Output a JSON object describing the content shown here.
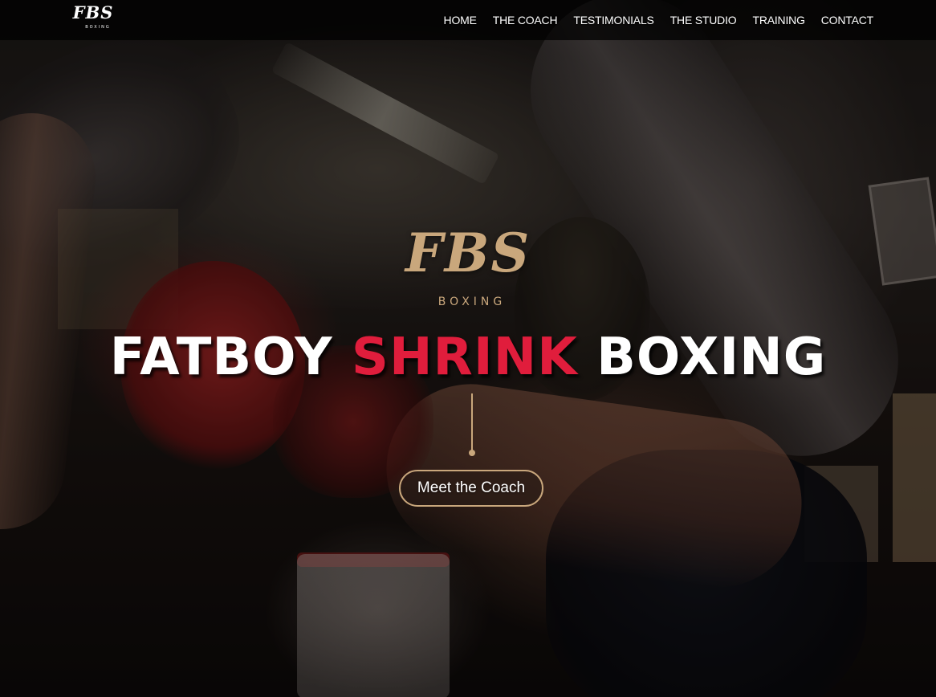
{
  "header": {
    "logo": {
      "mark": "FBS",
      "sub": "BOXING"
    },
    "nav": [
      {
        "label": "HOME"
      },
      {
        "label": "THE COACH"
      },
      {
        "label": "TESTIMONIALS"
      },
      {
        "label": "THE STUDIO"
      },
      {
        "label": "TRAINING"
      },
      {
        "label": "CONTACT"
      }
    ]
  },
  "hero": {
    "logo": {
      "mark": "FBS",
      "sub": "BOXING"
    },
    "title": {
      "part1": "FATBOY",
      "accent": "SHRINK",
      "part2": "BOXING"
    },
    "cta_label": "Meet the Coach"
  },
  "colors": {
    "accent_gold": "#c9a77c",
    "accent_red": "#e01d3c",
    "text": "#ffffff",
    "header_bg": "rgba(0,0,0,0.72)"
  }
}
